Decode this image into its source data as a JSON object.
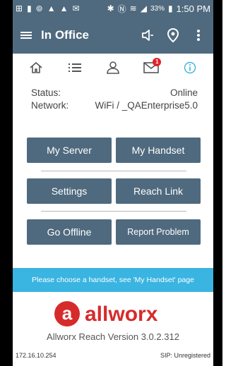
{
  "statusbar": {
    "battery_percent": "33%",
    "time": "1:50 PM"
  },
  "appbar": {
    "title": "In Office"
  },
  "tabs": {
    "messages_badge": "1"
  },
  "info": {
    "status_label": "Status:",
    "status_value": "Online",
    "network_label": "Network:",
    "network_value": "WiFi / _QAEnterprise5.0"
  },
  "buttons": {
    "my_server": "My Server",
    "my_handset": "My Handset",
    "settings": "Settings",
    "reach_link": "Reach Link",
    "go_offline": "Go Offline",
    "report_problem": "Report Problem"
  },
  "message": "Please choose a handset, see 'My Handset' page",
  "logo": {
    "brand": "allworx",
    "glyph": "a"
  },
  "version": "Allworx Reach Version 3.0.2.312",
  "footer": {
    "ip": "172.16.10.254",
    "sip_status": "SIP: Unregistered"
  },
  "colors": {
    "primary": "#4f6a7e",
    "accent": "#3ab4e1",
    "brand_red": "#d62b2b",
    "badge": "#e0222b"
  }
}
